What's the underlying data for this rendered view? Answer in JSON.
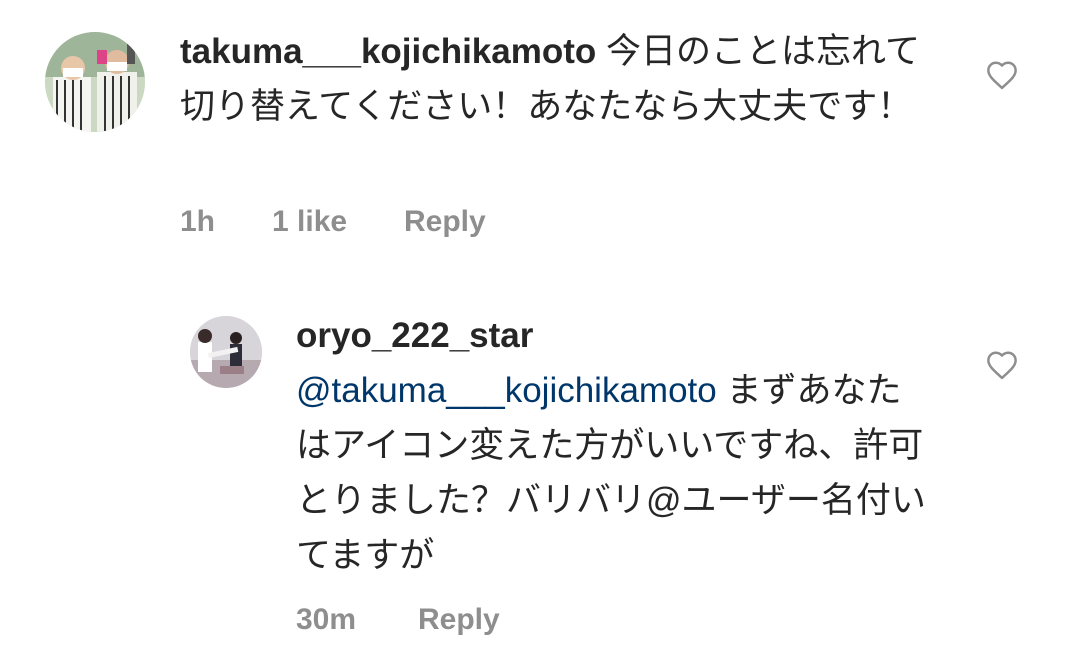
{
  "comments": [
    {
      "username": "takuma___kojichikamoto",
      "text": "今日のことは忘れて切り替えてください！あなたなら大丈夫です！",
      "time": "1h",
      "likes": "1 like",
      "reply_label": "Reply",
      "avatar_icon": "avatar-photo-icon",
      "like_icon": "heart-outline-icon"
    },
    {
      "username": "oryo_222_star",
      "mention": "@takuma___kojichikamoto",
      "text": "まずあなたはアイコン変えた方がいいですね、許可とりました？バリバリ@ユーザー名付いてますが",
      "time": "30m",
      "reply_label": "Reply",
      "avatar_icon": "avatar-photo-icon",
      "like_icon": "heart-outline-icon"
    }
  ],
  "colors": {
    "text": "#262626",
    "meta": "#8e8e8e",
    "mention": "#00376b"
  }
}
